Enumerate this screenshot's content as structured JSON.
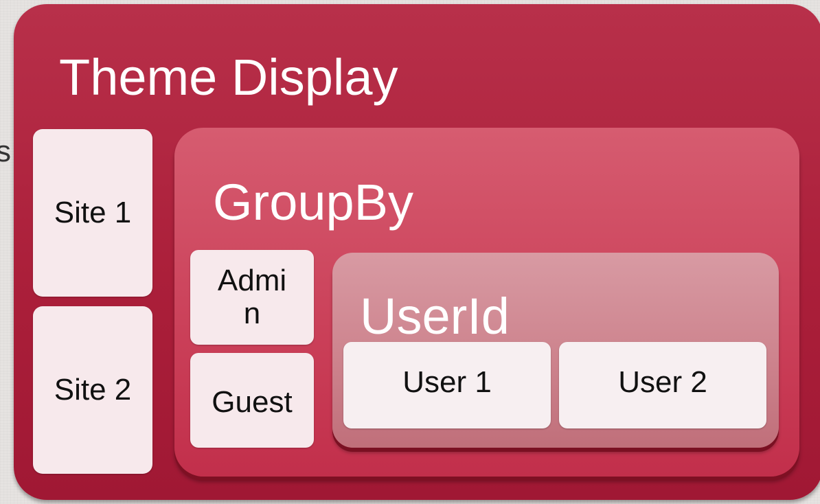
{
  "edge_text": "s",
  "theme_display": {
    "title": "Theme Display",
    "sites": [
      "Site 1",
      "Site 2"
    ]
  },
  "groupby": {
    "title": "GroupBy",
    "roles": [
      "Admin",
      "Guest"
    ]
  },
  "userid": {
    "title": "UserId",
    "users": [
      "User 1",
      "User 2"
    ]
  },
  "colors": {
    "outer_container": "#ab1f3a",
    "groupby_container": "#ca3f58",
    "userid_container": "#cd838d",
    "leaf_box": "#f7e9ec",
    "page_background": "#e6e3e1"
  }
}
